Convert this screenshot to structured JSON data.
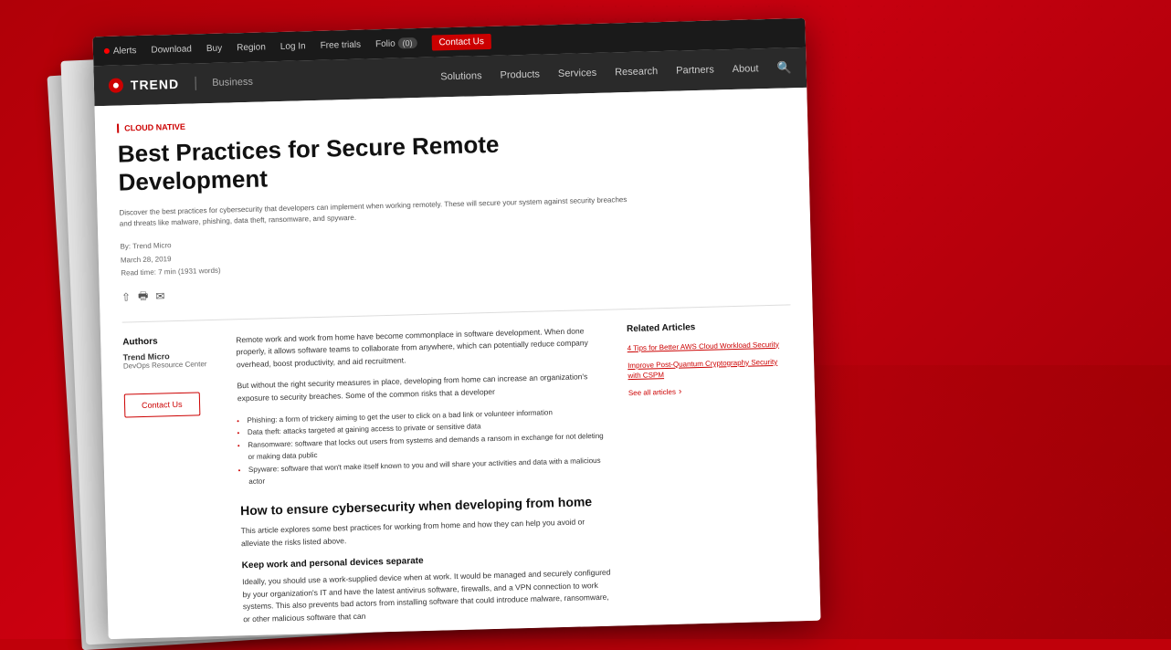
{
  "background": {
    "base_color": "#c0000a"
  },
  "top_nav": {
    "alerts_label": "Alerts",
    "download_label": "Download",
    "buy_label": "Buy",
    "region_label": "Region",
    "login_label": "Log In",
    "free_trials_label": "Free trials",
    "folio_label": "Folio",
    "folio_count": "(0)",
    "contact_us_label": "Contact Us"
  },
  "main_nav": {
    "logo_name": "TREND",
    "logo_suffix": "",
    "business_label": "Business",
    "links": [
      "Solutions",
      "Products",
      "Services",
      "Research",
      "Partners",
      "About"
    ]
  },
  "article": {
    "category": "Cloud Native",
    "title": "Best Practices for Secure Remote Development",
    "description": "Discover the best practices for cybersecurity that developers can implement when working remotely. These will secure your system against security breaches and threats like malware, phishing, data theft, ransomware, and spyware.",
    "author": "By: Trend Micro",
    "date": "March 28, 2019",
    "read_time": "Read time: 7 min (1931 words)",
    "intro_p1": "Remote work and work from home have become commonplace in software development. When done properly, it allows software teams to collaborate from anywhere, which can potentially reduce company overhead, boost productivity, and aid recruitment.",
    "intro_p2": "But without the right security measures in place, developing from home can increase an organization's exposure to security breaches. Some of the common risks that a developer",
    "risks": [
      "Phishing: a form of trickery aiming to get the user to click on a bad link or volunteer information",
      "Data theft: attacks targeted at gaining access to private or sensitive data",
      "Ransomware: software that locks out users from systems and demands a ransom in exchange for not deleting or making data public",
      "Spyware: software that won't make itself known to you and will share your activities and data with a malicious actor"
    ],
    "section1_heading": "How to ensure cybersecurity when developing from home",
    "section1_intro": "This article explores some best practices for working from home and how they can help you avoid or alleviate the risks listed above.",
    "sub_heading1": "Keep work and personal devices separate",
    "section2_body": "Ideally, you should use a work-supplied device when at work. It would be managed and securely configured by your organization's IT and have the latest antivirus software, firewalls, and a VPN connection to work systems. This also prevents bad actors from installing software that could introduce malware, ransomware, or other malicious software that can"
  },
  "authors": {
    "section_title": "Authors",
    "name": "Trend Micro",
    "role": "DevOps Resource Center",
    "contact_label": "Contact Us"
  },
  "related_articles": {
    "title": "Related Articles",
    "items": [
      "4 Tips for Better AWS Cloud Workload Security",
      "Improve Post-Quantum Cryptography Security with CSPM"
    ],
    "see_all_label": "See all articles"
  }
}
